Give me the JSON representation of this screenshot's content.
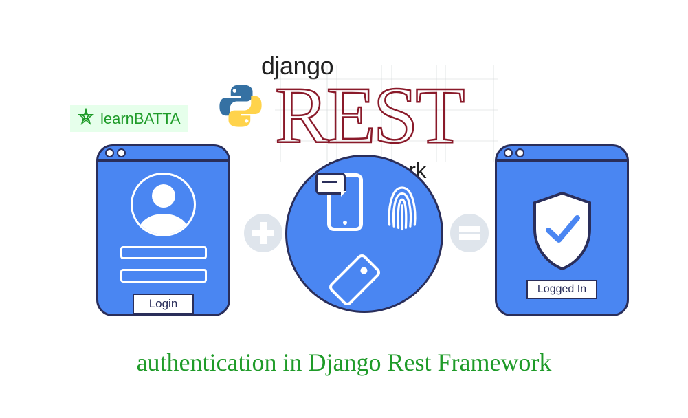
{
  "logo": {
    "text": "learnBATTA"
  },
  "drf": {
    "title": "django",
    "word": "REST",
    "subtitle": "framework"
  },
  "loginPanel": {
    "button": "Login"
  },
  "centerCircle": {
    "items": [
      "phone-message-icon",
      "fingerprint-icon",
      "keycard-icon"
    ]
  },
  "loggedInPanel": {
    "button": "Logged In"
  },
  "caption": "authentication in Django Rest Framework",
  "colors": {
    "brandGreen": "#1f9b29",
    "panelBlue": "#4a86f2",
    "outline": "#2a2e5a",
    "drfRed": "#8a1a2a",
    "pythonBlue": "#3571a3",
    "pythonYellow": "#ffd34b"
  }
}
